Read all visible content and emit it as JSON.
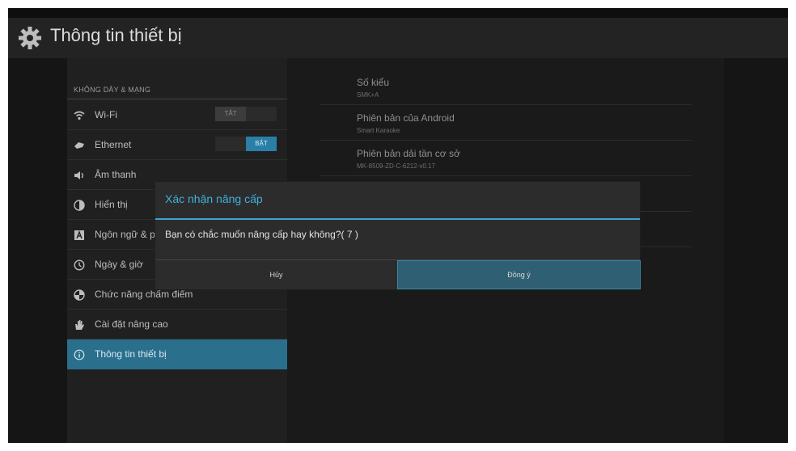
{
  "header": {
    "title": "Thông tin thiết bị",
    "icon": "gear-icon"
  },
  "sidebar": {
    "section_title": "KHÔNG DÂY & MẠNG",
    "items": [
      {
        "label": "Wi-Fi",
        "icon": "wifi-icon",
        "toggle": "TẮT"
      },
      {
        "label": "Ethernet",
        "icon": "ethernet-icon",
        "toggle": "BẬT"
      },
      {
        "label": "Âm thanh",
        "icon": "speaker-icon"
      },
      {
        "label": "Hiển thị",
        "icon": "display-icon"
      },
      {
        "label": "Ngôn ngữ & p",
        "icon": "language-icon"
      },
      {
        "label": "Ngày & giờ",
        "icon": "clock-icon"
      },
      {
        "label": "Chức năng chấm điểm",
        "icon": "scoring-icon"
      },
      {
        "label": "Cài đặt nâng cao",
        "icon": "hand-icon"
      },
      {
        "label": "Thông tin thiết bị",
        "icon": "info-icon"
      }
    ]
  },
  "info": {
    "items": [
      {
        "title": "Số kiểu",
        "value": "SMK+A"
      },
      {
        "title": "Phiên bản của Android",
        "value": "Smart Karaoke"
      },
      {
        "title": "Phiên bản dải tần cơ sở",
        "value": "MK-8509-ZD-C-6212-v0.17"
      }
    ]
  },
  "dialog": {
    "title": "Xác nhận nâng cấp",
    "message": "Bạn có chắc muốn nâng cấp hay không?( 7 )",
    "cancel_label": "Hủy",
    "ok_label": "Đồng ý"
  },
  "colors": {
    "accent": "#3fb1de",
    "selected": "#2a6f8c",
    "background": "#0e0e0e"
  }
}
